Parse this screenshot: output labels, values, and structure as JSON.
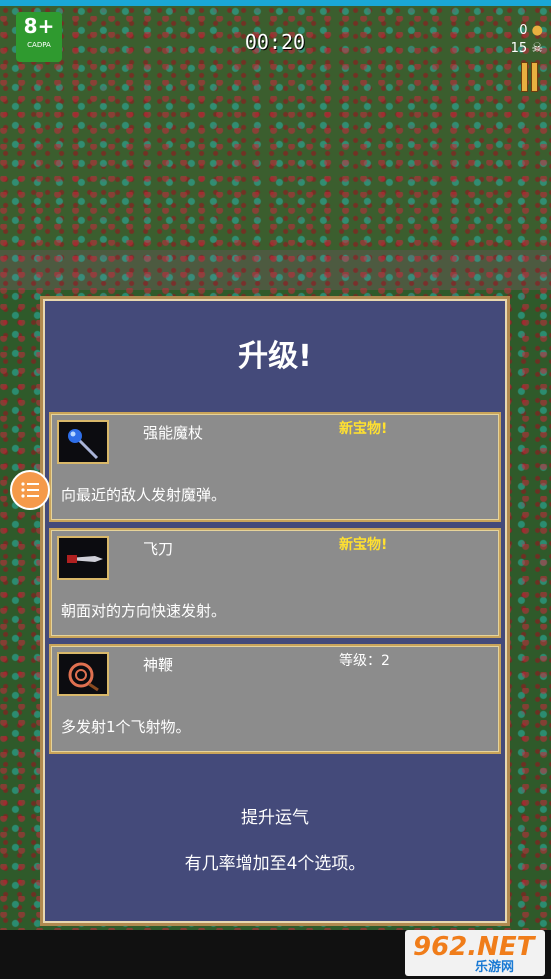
{
  "hud": {
    "rating_age": "8+",
    "rating_org": "CADPA",
    "timer": "00:20",
    "coins": "0",
    "kills": "15"
  },
  "panel": {
    "title": "升级!",
    "options": [
      {
        "name": "强能魔杖",
        "tag": "新宝物!",
        "desc": "向最近的敌人发射魔弹。",
        "icon": "magic-wand-icon"
      },
      {
        "name": "飞刀",
        "tag": "新宝物!",
        "desc": "朝面对的方向快速发射。",
        "icon": "knife-icon"
      },
      {
        "name": "神鞭",
        "tag": "等级：2",
        "desc": "多发射1个飞射物。",
        "icon": "whip-icon"
      }
    ],
    "luck_title": "提升运气",
    "luck_desc": "有几率增加至4个选项。"
  },
  "watermark": {
    "logo": "962.NET",
    "sub": "乐游网"
  },
  "colors": {
    "panel_bg": "#444a7a",
    "option_bg": "#8c8c8c",
    "new_tag": "#ffe030",
    "gold_border": "#c9a45a"
  }
}
